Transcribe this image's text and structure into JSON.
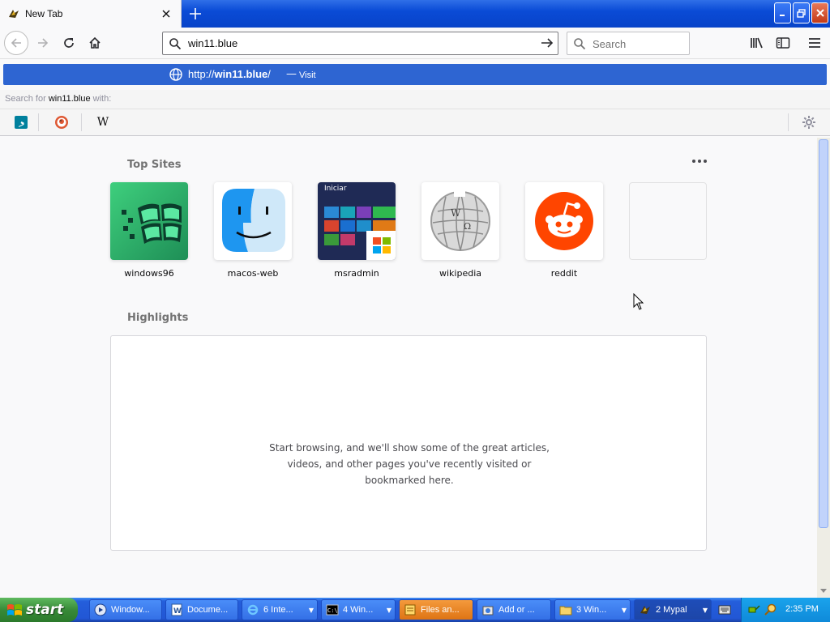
{
  "tab": {
    "title": "New Tab"
  },
  "nav": {
    "url_value": "win11.blue",
    "search_placeholder": "Search"
  },
  "suggestion": {
    "url_prefix": "http://",
    "url_host": "win11.blue",
    "url_suffix": "/",
    "dash": "—",
    "action": "Visit"
  },
  "search_with": {
    "prefix": "Search for ",
    "term": "win11.blue",
    "suffix": " with:"
  },
  "engines": [
    "bing-icon",
    "duckduckgo-icon",
    "wikipedia-icon"
  ],
  "engine_wikipedia_glyph": "W",
  "content": {
    "top_sites_title": "Top Sites",
    "highlights_title": "Highlights",
    "highlights_message": "Start browsing, and we'll show some of the great articles, videos, and other pages you've recently visited or bookmarked here.",
    "sites": [
      {
        "label": "windows96"
      },
      {
        "label": "macos-web"
      },
      {
        "label": "msradmin",
        "tile_text": "Iniciar"
      },
      {
        "label": "wikipedia"
      },
      {
        "label": "reddit"
      },
      {
        "label": ""
      }
    ]
  },
  "taskbar": {
    "start_label": "start",
    "tasks": [
      {
        "label": "Window..."
      },
      {
        "label": "Docume..."
      },
      {
        "label": "6 Inte..."
      },
      {
        "label": "4 Win..."
      },
      {
        "label": "Files an..."
      },
      {
        "label": "Add or ..."
      },
      {
        "label": "3 Win..."
      },
      {
        "label": "2 Mypal"
      }
    ],
    "clock": "2:35 PM"
  },
  "colors": {
    "titlebar": "#0a4bd6",
    "suggest_bg": "#2e65d2",
    "taskbar": "#245edb",
    "start": "#388a38",
    "reddit": "#ff4500"
  }
}
